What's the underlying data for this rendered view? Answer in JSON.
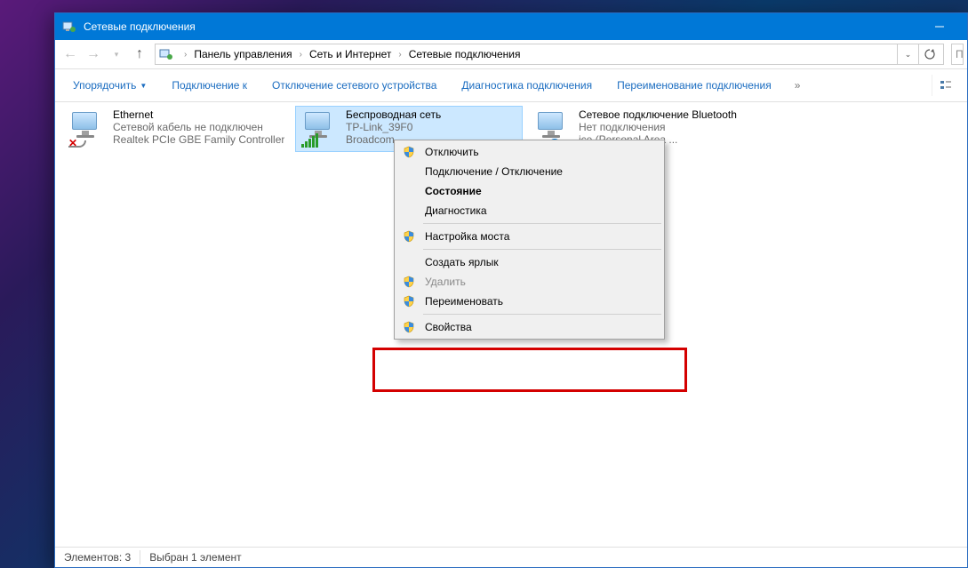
{
  "window": {
    "title": "Сетевые подключения"
  },
  "breadcrumb": {
    "items": [
      "Панель управления",
      "Сеть и Интернет",
      "Сетевые подключения"
    ]
  },
  "search": {
    "placeholder": "П"
  },
  "toolbar": {
    "organize": "Упорядочить",
    "connect_to": "Подключение к",
    "disable_device": "Отключение сетевого устройства",
    "diagnose": "Диагностика подключения",
    "rename": "Переименование подключения"
  },
  "connections": [
    {
      "name": "Ethernet",
      "status": "Сетевой кабель не подключен",
      "device": "Realtek PCIe GBE Family Controller",
      "kind": "ethernet",
      "badge": "x"
    },
    {
      "name": "Беспроводная сеть",
      "status": "TP-Link_39F0",
      "device": "Broadcom",
      "kind": "wifi",
      "selected": true
    },
    {
      "name": "Сетевое подключение Bluetooth",
      "status": "Нет подключения",
      "device": "ice (Personal Area ...",
      "kind": "bluetooth",
      "badge": "bt"
    }
  ],
  "context_menu": {
    "items": [
      {
        "label": "Отключить",
        "shield": true
      },
      {
        "label": "Подключение / Отключение"
      },
      {
        "label": "Состояние",
        "bold": true
      },
      {
        "label": "Диагностика"
      },
      {
        "sep": true
      },
      {
        "label": "Настройка моста",
        "shield": true
      },
      {
        "sep": true
      },
      {
        "label": "Создать ярлык"
      },
      {
        "label": "Удалить",
        "shield": true,
        "disabled": true
      },
      {
        "label": "Переименовать",
        "shield": true
      },
      {
        "sep": true
      },
      {
        "label": "Свойства",
        "shield": true
      }
    ]
  },
  "statusbar": {
    "count": "Элементов: 3",
    "selection": "Выбран 1 элемент"
  }
}
